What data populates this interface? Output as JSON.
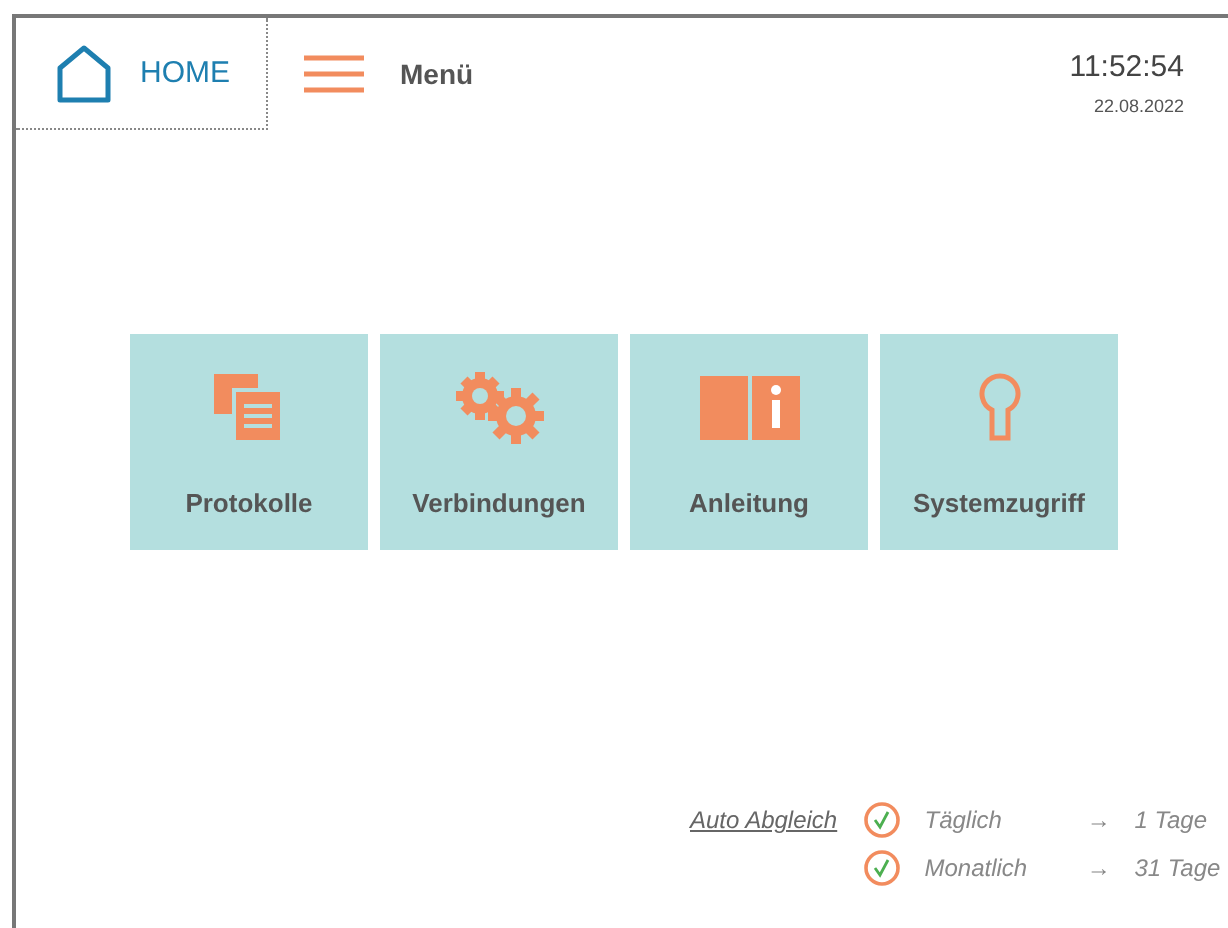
{
  "header": {
    "home": {
      "label": "HOME"
    },
    "menu": {
      "label": "Menü"
    },
    "time": "11:52:54",
    "date": "22.08.2022"
  },
  "tiles": [
    {
      "kind": "documents",
      "label": "Protokolle"
    },
    {
      "kind": "gears",
      "label": "Verbindungen"
    },
    {
      "kind": "book",
      "label": "Anleitung"
    },
    {
      "kind": "keyhole",
      "label": "Systemzugriff"
    }
  ],
  "sync": {
    "link": "Auto Abgleich",
    "items": [
      {
        "checked": true,
        "label": "Täglich",
        "arrow": "→",
        "value": "1 Tage"
      },
      {
        "checked": true,
        "label": "Monatlich",
        "arrow": "→",
        "value": "31 Tage"
      }
    ]
  }
}
